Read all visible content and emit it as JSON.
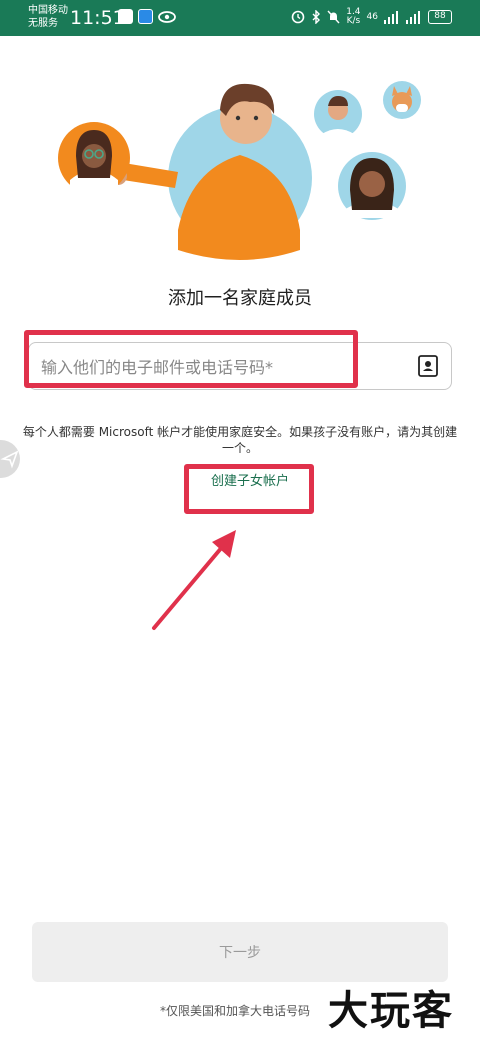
{
  "status_bar": {
    "carrier_line1": "中国移动",
    "carrier_line2": "无服务",
    "time": "11:51",
    "speed_value": "1.4",
    "speed_unit": "K/s",
    "network": "46",
    "battery": "88"
  },
  "page": {
    "heading": "添加一名家庭成员",
    "input_placeholder": "输入他们的电子邮件或电话号码*",
    "info_text": "每个人都需要 Microsoft 帐户才能使用家庭安全。如果孩子没有账户，请为其创建一个。",
    "create_child_link": "创建子女帐户",
    "next_button": "下一步",
    "footnote": "*仅限美国和加拿大电话号码"
  },
  "watermark": "大玩客",
  "colors": {
    "status_bar": "#1a7a57",
    "annotation_red": "#e0314b",
    "link_green": "#1a6f4e",
    "illustration_orange": "#f28a1e",
    "illustration_blue": "#9fd6e8"
  },
  "icons": {
    "contact": "contact-book-icon",
    "side": "send-arrow-icon"
  }
}
